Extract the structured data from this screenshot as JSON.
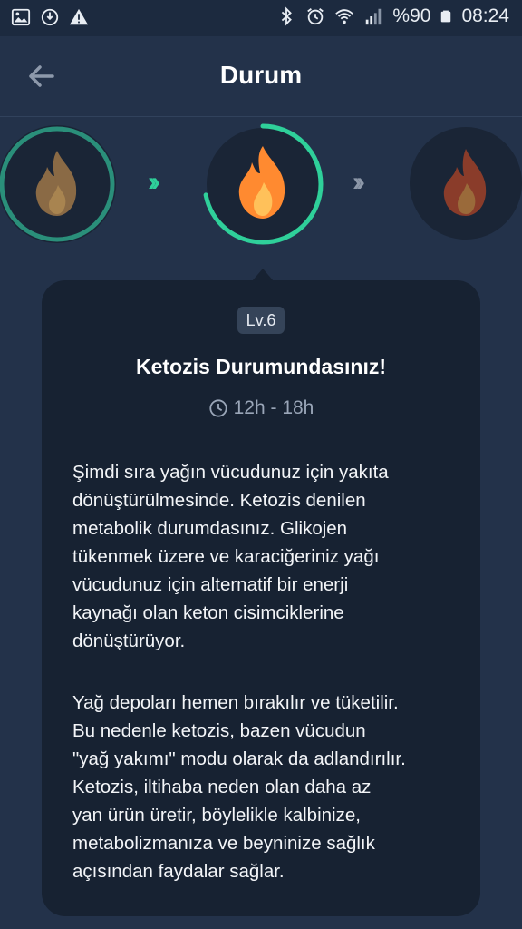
{
  "status_bar": {
    "battery": "%90",
    "time": "08:24",
    "icons_left": [
      "image-icon",
      "sync-icon",
      "warning-icon"
    ],
    "icons_right": [
      "bluetooth-icon",
      "alarm-icon",
      "wifi-icon",
      "signal-icon",
      "battery-icon"
    ]
  },
  "header": {
    "title": "Durum",
    "back_icon": "arrow-left-icon"
  },
  "levels": {
    "current_progress": 0.72,
    "colors": {
      "accent": "#2fd09a",
      "flame_current": "#ff8a30",
      "flame_prev": "#8a6a45",
      "flame_next": "#8a3c2a"
    }
  },
  "card": {
    "level_badge": "Lv.6",
    "title": "Ketozis Durumundasınız!",
    "time_range": "12h - 18h",
    "paragraph1": "Şimdi sıra yağın vücudunuz için yakıta\ndönüştürülmesinde. Ketozis denilen\nmetabolik durumdasınız. Glikojen\ntükenmek üzere ve karaciğeriniz yağı\nvücudunuz için alternatif bir enerji\nkaynağı olan keton cisimciklerine\ndönüştürüyor.",
    "paragraph2": "Yağ depoları hemen bırakılır ve tüketilir.\nBu nedenle ketozis, bazen vücudun\n\"yağ yakımı\" modu olarak da adlandırılır.\nKetozis, iltihaba neden olan daha az\nyan ürün üretir, böylelikle kalbinize,\nmetabolizmanıza ve beyninize sağlık\naçısından faydalar sağlar."
  }
}
